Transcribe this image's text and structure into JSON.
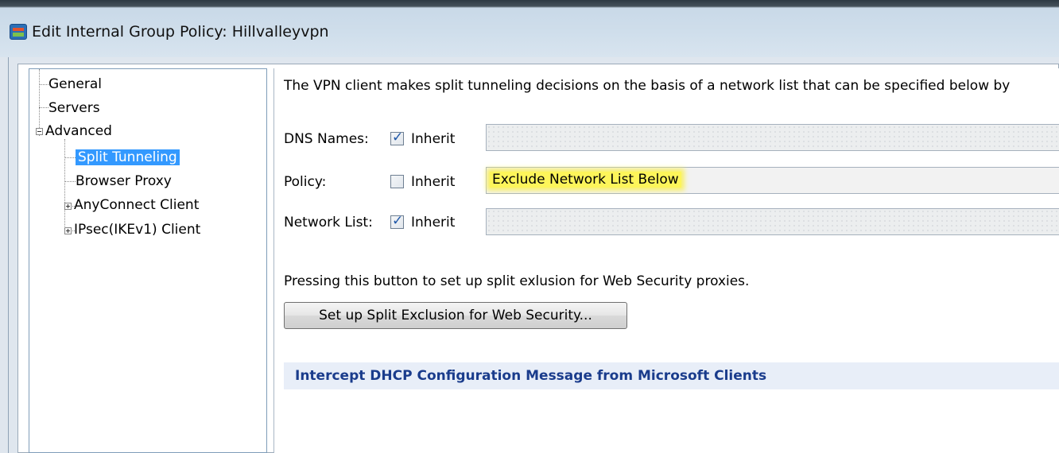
{
  "window": {
    "title": "Edit Internal Group Policy: Hillvalleyvpn",
    "icon": "asdm-window-icon"
  },
  "tree": {
    "items": [
      {
        "label": "General"
      },
      {
        "label": "Servers"
      },
      {
        "label": "Advanced"
      },
      {
        "label": "Split Tunneling"
      },
      {
        "label": "Browser Proxy"
      },
      {
        "label": "AnyConnect Client"
      },
      {
        "label": "IPsec(IKEv1) Client"
      }
    ],
    "selected": "Split Tunneling"
  },
  "split_tunneling": {
    "description": "The VPN client makes split tunneling decisions on the basis of a network list that can be specified below by",
    "dns_names": {
      "label": "DNS Names:",
      "inherit_label": "Inherit",
      "inherit_checked": true,
      "value": ""
    },
    "policy": {
      "label": "Policy:",
      "inherit_label": "Inherit",
      "inherit_checked": false,
      "value": "Exclude Network List Below"
    },
    "network_list": {
      "label": "Network List:",
      "inherit_label": "Inherit",
      "inherit_checked": true,
      "value": ""
    },
    "web_security_note": "Pressing this button to set up split exlusion for Web Security proxies.",
    "web_security_button": "Set up Split Exclusion for Web Security...",
    "dhcp_section": "Intercept DHCP Configuration Message from Microsoft Clients"
  },
  "colors": {
    "selection": "#3399ff",
    "highlight": "#fdf55a",
    "section_text": "#1a3c8c"
  }
}
